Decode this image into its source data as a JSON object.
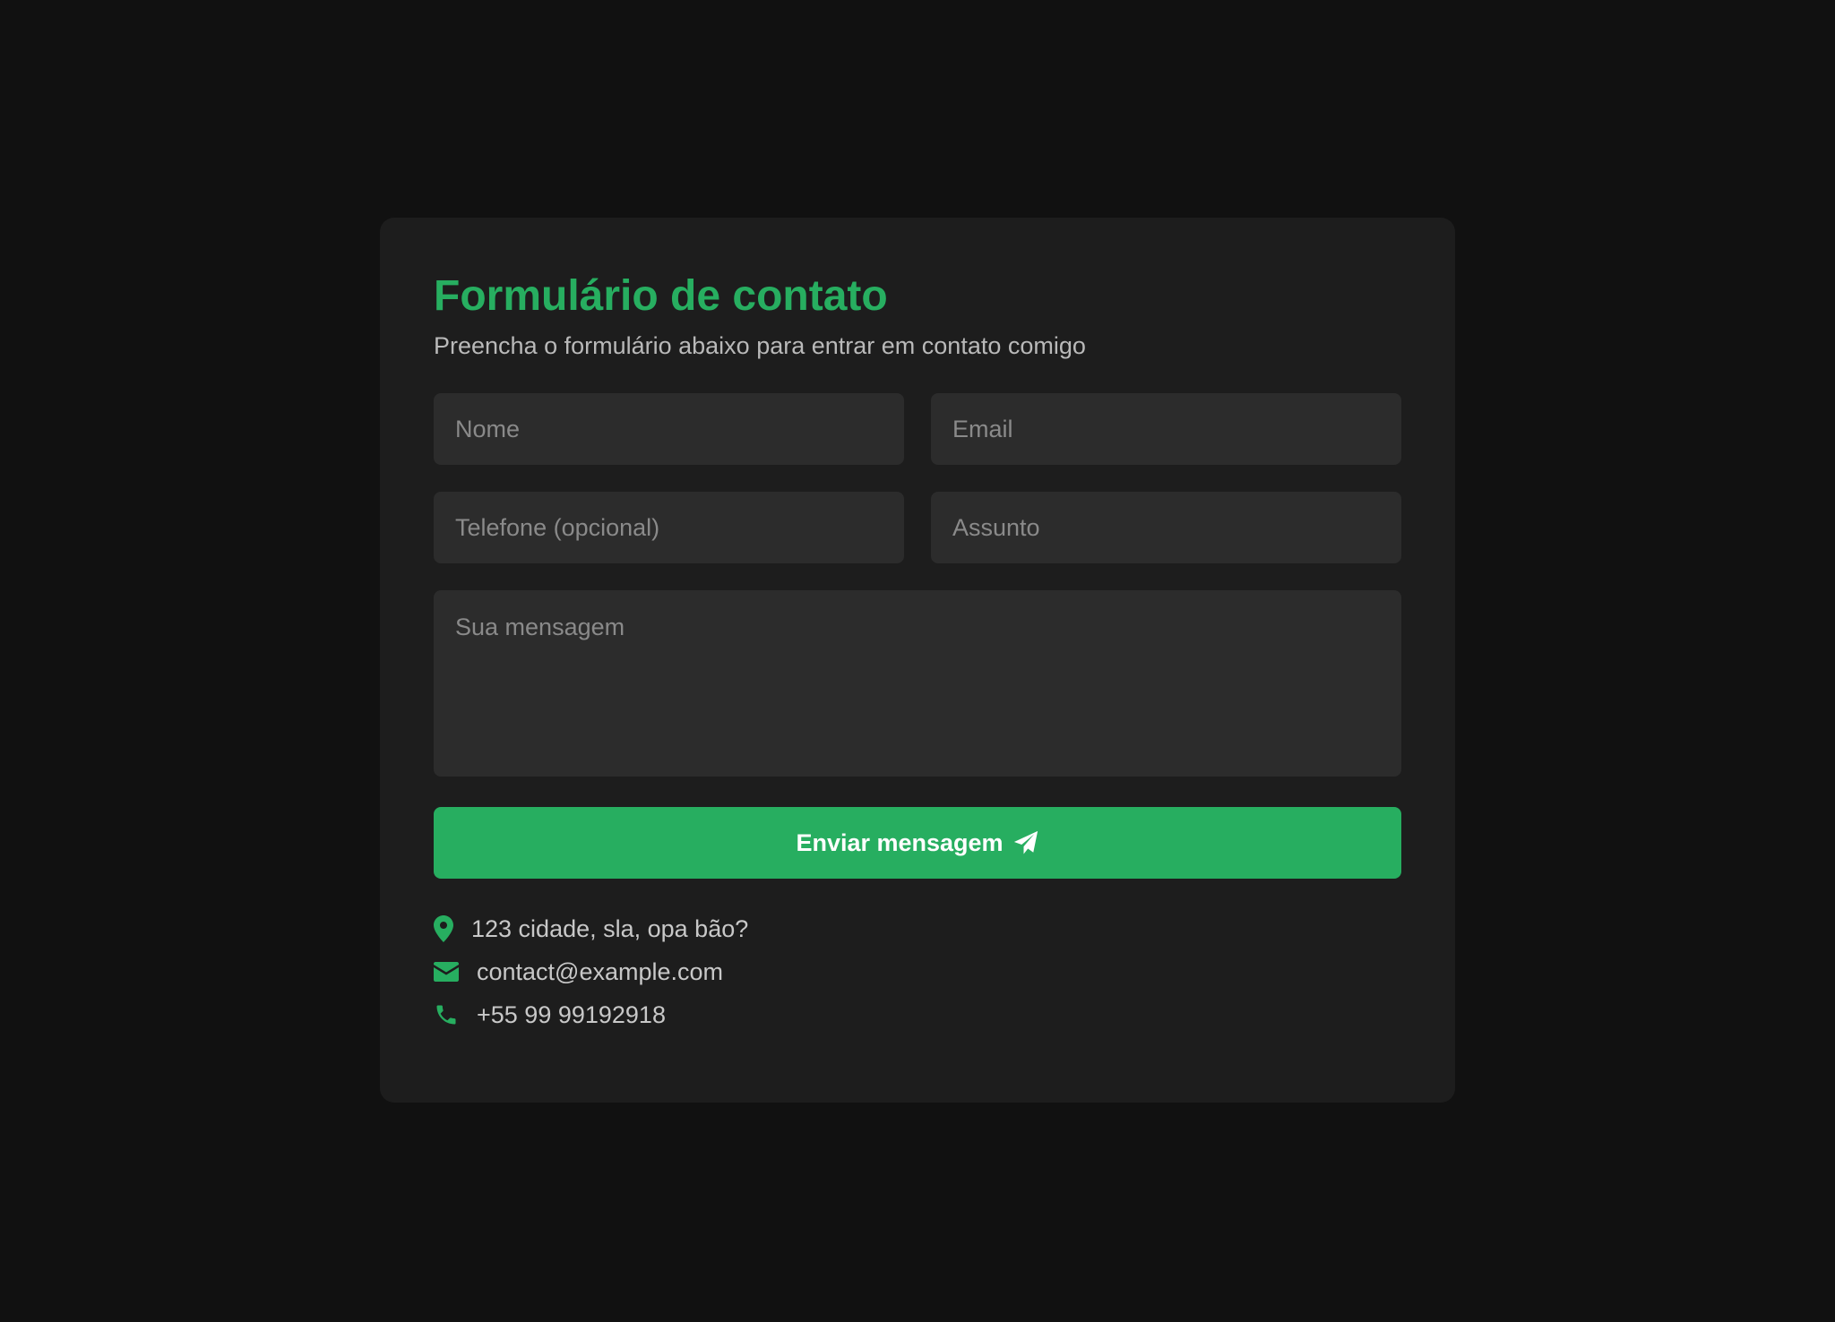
{
  "form": {
    "title": "Formulário de contato",
    "subtitle": "Preencha o formulário abaixo para entrar em contato comigo",
    "name_placeholder": "Nome",
    "email_placeholder": "Email",
    "phone_placeholder": "Telefone (opcional)",
    "subject_placeholder": "Assunto",
    "message_placeholder": "Sua mensagem",
    "submit_label": "Enviar mensagem",
    "submit_icon": "paper-plane-icon"
  },
  "contact_info": {
    "address": "123 cidade, sla, opa bão?",
    "address_icon": "map-pin-icon",
    "email": "contact@example.com",
    "email_icon": "envelope-icon",
    "phone": "+55 99 99192918",
    "phone_icon": "phone-icon"
  },
  "colors": {
    "page_background": "#111111",
    "card_background": "#1d1d1d",
    "field_background": "#2c2c2c",
    "accent": "#27ae60",
    "text": "#c8c8c8",
    "placeholder": "#8a8a8a"
  }
}
